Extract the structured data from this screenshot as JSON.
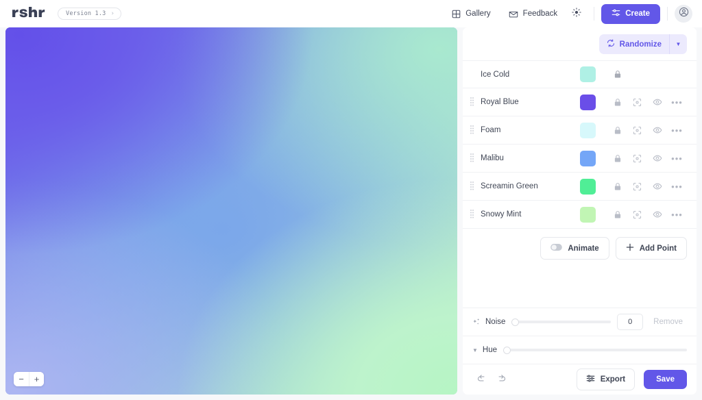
{
  "header": {
    "logo_alt": "mshr",
    "version_label": "Version 1.3",
    "version_chevron": "›",
    "nav": [
      {
        "label": "Gallery",
        "icon": "grid-icon"
      },
      {
        "label": "Feedback",
        "icon": "envelope-icon"
      }
    ],
    "theme_toggle_icon": "sun-icon",
    "create_label": "Create",
    "avatar_icon": "user-avatar-icon"
  },
  "canvas": {
    "zoom_out_label": "−",
    "zoom_in_label": "+",
    "gradient_colors": [
      "#6350E9",
      "#7BA7EA",
      "#ADB6F2",
      "#A9E9CF",
      "#BDF3C6"
    ]
  },
  "panel": {
    "randomize_label": "Randomize",
    "randomize_icon": "refresh-icon",
    "randomize_caret": "▼",
    "rows": [
      {
        "name": "Ice Cold",
        "color": "#AFF0E5",
        "locked": true,
        "has_extra_icons": false,
        "draggable": false
      },
      {
        "name": "Royal Blue",
        "color": "#6A4EE8",
        "locked": false,
        "has_extra_icons": true,
        "draggable": true
      },
      {
        "name": "Foam",
        "color": "#D7F8FB",
        "locked": false,
        "has_extra_icons": true,
        "draggable": true
      },
      {
        "name": "Malibu",
        "color": "#74A6F7",
        "locked": false,
        "has_extra_icons": true,
        "draggable": true
      },
      {
        "name": "Screamin Green",
        "color": "#50EE96",
        "locked": false,
        "has_extra_icons": true,
        "draggable": true
      },
      {
        "name": "Snowy Mint",
        "color": "#C1F5B4",
        "locked": false,
        "has_extra_icons": true,
        "draggable": true
      }
    ],
    "animate_label": "Animate",
    "add_point_label": "Add Point",
    "noise": {
      "label": "Noise",
      "icon": "sparkle-icon",
      "value": "0",
      "slider_percent": 0,
      "remove_label": "Remove"
    },
    "hue": {
      "label": "Hue",
      "caret": "▼",
      "slider_percent": 0
    },
    "footer": {
      "undo_icon": "undo-arrow-icon",
      "redo_icon": "redo-arrow-icon",
      "export_label": "Export",
      "save_label": "Save"
    }
  },
  "colors": {
    "accent": "#6257E8",
    "accent_soft": "#ECEAFD",
    "panel_bg": "#FFFFFF",
    "page_bg": "#F7F8FA"
  }
}
